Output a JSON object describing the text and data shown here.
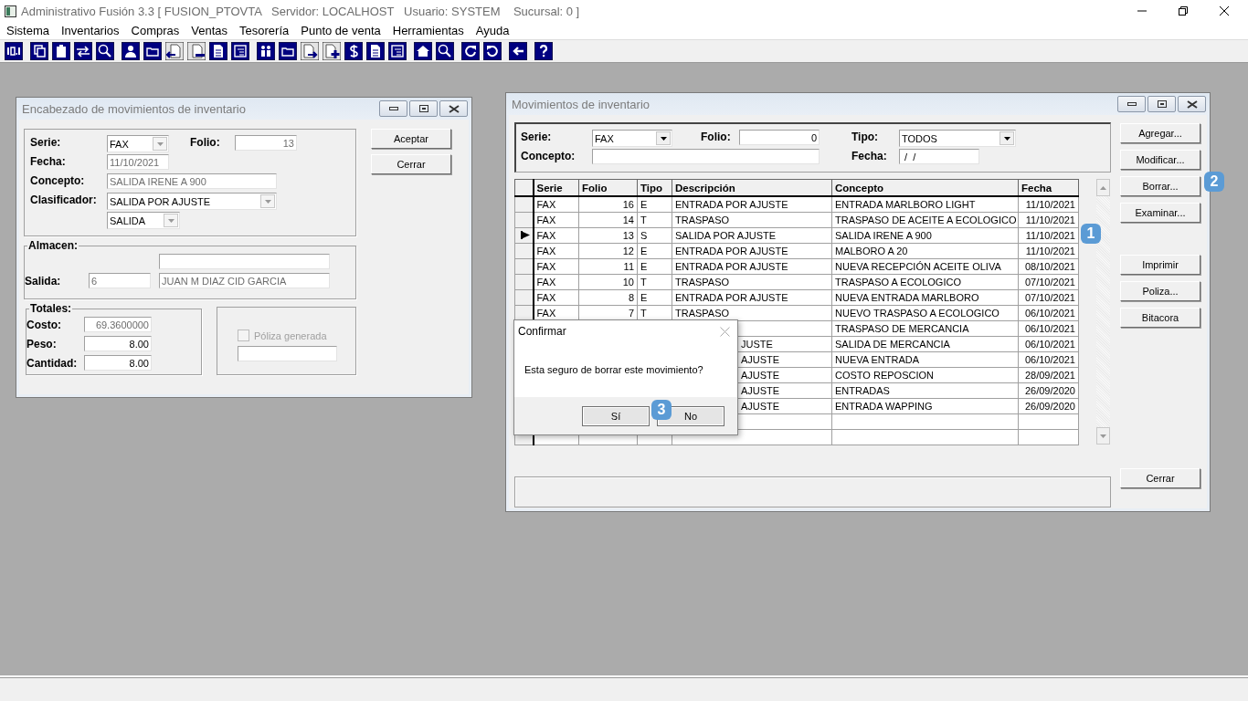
{
  "app_window": {
    "title": "Administrativo Fusión 3.3 [ FUSION_PTOVTA   Servidor: LOCALHOST   Usuario: SYSTEM    Sucursal: 0 ]"
  },
  "menu": [
    "Sistema",
    "Inventarios",
    "Compras",
    "Ventas",
    "Tesorería",
    "Punto de venta",
    "Herramientas",
    "Ayuda"
  ],
  "header_window": {
    "title": "Encabezado de movimientos de inventario",
    "serie": {
      "label": "Serie:",
      "value": "FAX",
      "disabled": false
    },
    "folio": {
      "label": "Folio:",
      "value": "13",
      "disabled": true
    },
    "fecha": {
      "label": "Fecha:",
      "value": "11/10/2021",
      "disabled": true
    },
    "concepto": {
      "label": "Concepto:",
      "value": "SALIDA IRENE A 900",
      "disabled": true
    },
    "clasificador": {
      "label": "Clasificador:",
      "value": "SALIDA POR AJUSTE",
      "disabled": false
    },
    "clasificador_tipo": {
      "value": "SALIDA",
      "disabled": false
    },
    "almacen": {
      "legend": "Almacen:",
      "salida_label": "Salida:",
      "salida_value": "6",
      "salida_name": "JUAN M DIAZ CID GARCIA",
      "disabled": true
    },
    "totales": {
      "legend": "Totales:",
      "items": [
        {
          "label": "Costo:",
          "value": "69.3600000",
          "disabled": true
        },
        {
          "label": "Peso:",
          "value": "8.00",
          "disabled": false
        },
        {
          "label": "Cantidad:",
          "value": "8.00",
          "disabled": false
        }
      ]
    },
    "poliza": {
      "label": "Póliza generada",
      "checked": false,
      "disabled": true
    },
    "buttons": [
      "Aceptar",
      "Cerrar"
    ]
  },
  "movements_window": {
    "title": "Movimientos de inventario",
    "filters": {
      "serie_label": "Serie:",
      "serie": "FAX",
      "folio_label": "Folio:",
      "folio": "0",
      "tipo_label": "Tipo:",
      "tipo": "TODOS",
      "concepto_label": "Concepto:",
      "fecha_label": "Fecha:",
      "fecha": " /  /"
    },
    "columns": [
      "Serie",
      "Folio",
      "Tipo",
      "Descripción",
      "Concepto",
      "Fecha"
    ],
    "rows": [
      {
        "serie": "FAX",
        "folio": "16",
        "tipo": "E",
        "descripcion": "ENTRADA POR AJUSTE",
        "concepto": "ENTRADA MARLBORO LIGHT",
        "fecha": "11/10/2021",
        "selected": false
      },
      {
        "serie": "FAX",
        "folio": "14",
        "tipo": "T",
        "descripcion": "TRASPASO",
        "concepto": "TRASPASO DE ACEITE A ECOLOGICO",
        "fecha": "11/10/2021",
        "selected": false
      },
      {
        "serie": "FAX",
        "folio": "13",
        "tipo": "S",
        "descripcion": "SALIDA POR AJUSTE",
        "concepto": "SALIDA IRENE A 900",
        "fecha": "11/10/2021",
        "selected": true
      },
      {
        "serie": "FAX",
        "folio": "12",
        "tipo": "E",
        "descripcion": "ENTRADA POR AJUSTE",
        "concepto": "MALBORO A 20",
        "fecha": "11/10/2021",
        "selected": false
      },
      {
        "serie": "FAX",
        "folio": "11",
        "tipo": "E",
        "descripcion": "ENTRADA POR AJUSTE",
        "concepto": "NUEVA RECEPCIÓN ACEITE OLIVA",
        "fecha": "08/10/2021",
        "selected": false
      },
      {
        "serie": "FAX",
        "folio": "10",
        "tipo": "T",
        "descripcion": "TRASPASO",
        "concepto": "TRASPASO A ECOLOGICO",
        "fecha": "07/10/2021",
        "selected": false
      },
      {
        "serie": "FAX",
        "folio": "8",
        "tipo": "E",
        "descripcion": "ENTRADA POR AJUSTE",
        "concepto": "NUEVA ENTRADA MARLBORO",
        "fecha": "07/10/2021",
        "selected": false
      },
      {
        "serie": "FAX",
        "folio": "7",
        "tipo": "T",
        "descripcion": "TRASPASO",
        "concepto": "NUEVO TRASPASO A ECOLOGICO",
        "fecha": "06/10/2021",
        "selected": false
      },
      {
        "concepto": "TRASPASO DE MERCANCIA",
        "fecha": "06/10/2021"
      },
      {
        "descripcion": "JUSTE",
        "concepto": "SALIDA DE MERCANCIA",
        "fecha": "06/10/2021"
      },
      {
        "descripcion": "AJUSTE",
        "concepto": "NUEVA ENTRADA",
        "fecha": "06/10/2021"
      },
      {
        "descripcion": "AJUSTE",
        "concepto": "COSTO REPOSCION",
        "fecha": "28/09/2021"
      },
      {
        "descripcion": "AJUSTE",
        "concepto": "ENTRADAS",
        "fecha": "26/09/2020"
      },
      {
        "descripcion": "AJUSTE",
        "concepto": "ENTRADA WAPPING",
        "fecha": "26/09/2020"
      }
    ],
    "button_groups": [
      [
        "Agregar...",
        "Modificar...",
        "Borrar...",
        "Examinar..."
      ],
      [
        "Imprimir",
        "Poliza...",
        "Bitacora"
      ],
      [
        "Cerrar"
      ]
    ]
  },
  "confirm_dialog": {
    "title": "Confirmar",
    "message": "Esta seguro de borrar este movimiento?",
    "buttons": [
      "Sí",
      "No"
    ]
  },
  "callouts": [
    "1",
    "2",
    "3"
  ]
}
